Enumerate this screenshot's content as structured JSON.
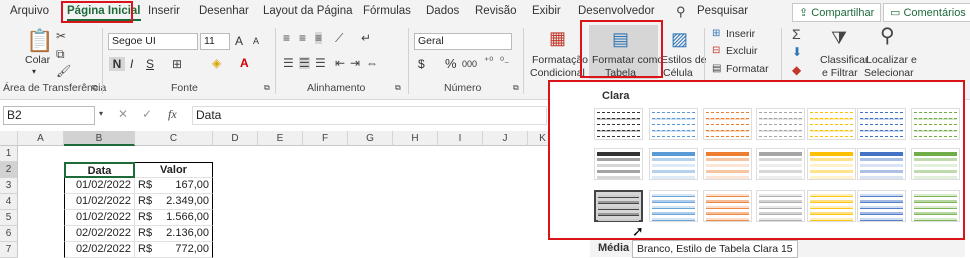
{
  "tabs": [
    "Arquivo",
    "Página Inicial",
    "Inserir",
    "Desenhar",
    "Layout da Página",
    "Fórmulas",
    "Dados",
    "Revisão",
    "Exibir",
    "Desenvolvedor"
  ],
  "search_label": "Pesquisar",
  "share_label": "Compartilhar",
  "comments_label": "Comentários",
  "ribbon": {
    "clipboard": {
      "paste": "Colar",
      "group": "Área de Transferência"
    },
    "font": {
      "name": "Segoe UI",
      "size": "11",
      "bold": "N",
      "italic": "I",
      "underline": "S",
      "grow": "A",
      "shrink": "A",
      "group": "Fonte"
    },
    "alignment": {
      "group": "Alinhamento"
    },
    "number": {
      "format": "Geral",
      "currency": "$",
      "percent": "%",
      "comma": "000",
      "group": "Número"
    },
    "styles": {
      "conditional_line1": "Formatação",
      "conditional_line2": "Condicional",
      "format_table_line1": "Formatar como",
      "format_table_line2": "Tabela",
      "cell_styles_line1": "Estilos de",
      "cell_styles_line2": "Célula"
    },
    "cells": {
      "insert": "Inserir",
      "delete": "Excluir",
      "format": "Formatar"
    },
    "editing": {
      "sort_line1": "Classificar",
      "sort_line2": "e Filtrar",
      "find_line1": "Localizar e",
      "find_line2": "Selecionar"
    }
  },
  "name_box": "B2",
  "formula_value": "Data",
  "fx_label": "fx",
  "columns": [
    "A",
    "B",
    "C",
    "D",
    "E",
    "F",
    "G",
    "H",
    "I",
    "J",
    "K"
  ],
  "rows": [
    "1",
    "2",
    "3",
    "4",
    "5",
    "6",
    "7"
  ],
  "table": {
    "header_data": "Data",
    "header_valor": "Valor",
    "rows": [
      {
        "date": "01/02/2022",
        "cur": "R$",
        "val": "167,00"
      },
      {
        "date": "01/02/2022",
        "cur": "R$",
        "val": "2.349,00"
      },
      {
        "date": "01/02/2022",
        "cur": "R$",
        "val": "1.566,00"
      },
      {
        "date": "02/02/2022",
        "cur": "R$",
        "val": "2.136,00"
      },
      {
        "date": "02/02/2022",
        "cur": "R$",
        "val": "772,00"
      }
    ]
  },
  "gallery": {
    "section_light": "Clara",
    "section_medium": "Média",
    "tooltip": "Branco, Estilo de Tabela Clara 15",
    "accent_colors": [
      "#333333",
      "#5b9bd5",
      "#ed7d31",
      "#a5a5a5",
      "#ffc000",
      "#4472c4",
      "#70ad47"
    ]
  }
}
